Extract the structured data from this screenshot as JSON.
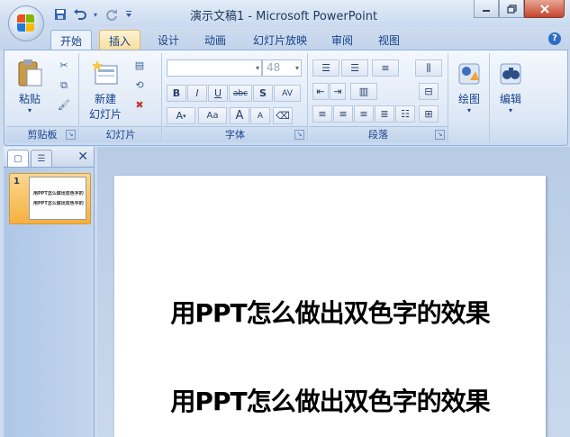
{
  "window": {
    "title": "演示文稿1 - Microsoft PowerPoint",
    "controls": [
      "minimize-icon",
      "restore-icon",
      "close-icon"
    ]
  },
  "quick_access": [
    "save-icon",
    "undo-icon",
    "redo-icon",
    "customize-icon"
  ],
  "tabs": [
    {
      "label": "开始",
      "state": "active"
    },
    {
      "label": "插入",
      "state": "hover"
    },
    {
      "label": "设计"
    },
    {
      "label": "动画"
    },
    {
      "label": "幻灯片放映"
    },
    {
      "label": "审阅"
    },
    {
      "label": "视图"
    }
  ],
  "ribbon": {
    "clipboard": {
      "label": "剪贴板",
      "paste": "粘贴"
    },
    "slides": {
      "label": "幻灯片",
      "new_slide_line1": "新建",
      "new_slide_line2": "幻灯片"
    },
    "font": {
      "label": "字体",
      "font_name": "",
      "font_size": "48",
      "buttons": [
        "B",
        "I",
        "U",
        "abc",
        "S",
        "AV"
      ],
      "buttons2": [
        "A",
        "Aa",
        "A",
        "A"
      ]
    },
    "paragraph": {
      "label": "段落"
    },
    "drawing": {
      "label": "绘图"
    },
    "editing": {
      "label": "编辑"
    }
  },
  "slide_pane": {
    "slide_number": "1",
    "thumb_line1": "用PPT怎么做出双色字的效果",
    "thumb_line2": "用PPT怎么做出双色字的效果"
  },
  "slide": {
    "line1": "用PPT怎么做出双色字的效果",
    "line2": "用PPT怎么做出双色字的效果"
  },
  "colors": {
    "accent": "#15428b",
    "ribbon": "#dce7f5",
    "hover_tab": "#f9dd9a",
    "thumb_highlight": "#f6b040"
  }
}
